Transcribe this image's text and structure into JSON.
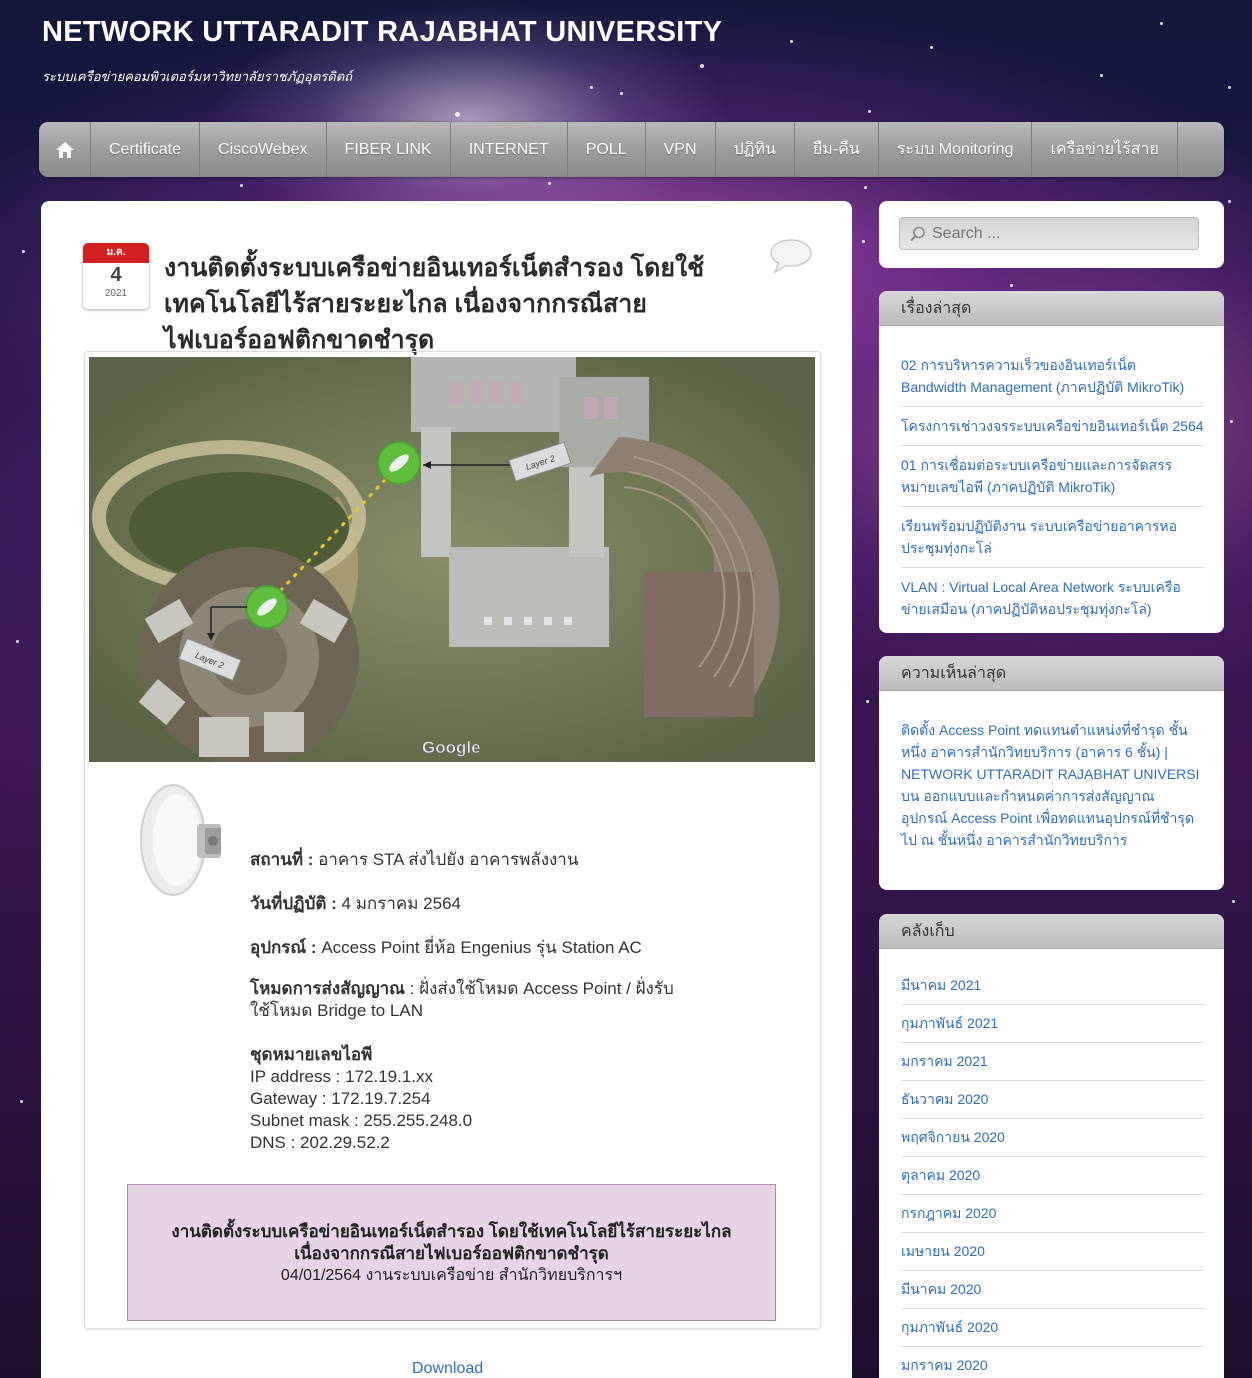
{
  "site": {
    "title": "NETWORK UTTARADIT RAJABHAT UNIVERSITY",
    "subtitle": "ระบบเครือข่ายคอมพิวเตอร์มหาวิทยาลัยราชภัฏอุตรดิตถ์"
  },
  "nav": {
    "items": [
      "Certificate",
      "CiscoWebex",
      "FIBER LINK",
      "INTERNET",
      "POLL",
      "VPN",
      "ปฏิทิน",
      "ยืม-คืน",
      "ระบบ Monitoring",
      "เครือข่ายไร้สาย"
    ]
  },
  "post": {
    "date": {
      "month": "ม.ค.",
      "day": "4",
      "year": "2021"
    },
    "title": "งานติดตั้งระบบเครือข่ายอินเทอร์เน็ตสำรอง โดยใช้เทคโนโลยีไร้สายระยะไกล เนื่องจากกรณีสายไฟเบอร์ออฟติกขาดชำรุด",
    "map_labels": {
      "layer": "Layer 2",
      "google": "Google"
    },
    "location_label": "สถานที่ :",
    "location_value": " อาคาร STA ส่งไปยัง อาคารพลังงาน",
    "date_label": "วันที่ปฏิบัติ :",
    "date_value": " 4 มกราคม 2564",
    "device_label": "อุปกรณ์ :",
    "device_value": " Access Point ยี่ห้อ Engenius รุ่น Station AC",
    "mode_label": "โหมดการส่งสัญญาณ",
    "mode_value": " : ฝั่งส่งใช้โหมด Access Point / ฝั่งรับ",
    "mode_value2": "ใช้โหมด Bridge to LAN",
    "ip_heading": "ชุดหมายเลขไอพี",
    "ip_address": "IP address : 172.19.1.xx",
    "gateway": "Gateway : 172.19.7.254",
    "subnet": "Subnet mask : 255.255.248.0",
    "dns": "DNS : 202.29.52.2",
    "summary_title_1": "งานติดตั้งระบบเครือข่ายอินเทอร์เน็ตสำรอง โดยใช้เทคโนโลยีไร้สายระยะไกล",
    "summary_title_2": "เนื่องจากกรณีสายไฟเบอร์ออฟติกขาดชำรุด",
    "summary_sub": "04/01/2564  งานระบบเครือข่าย สำนักวิทยบริการฯ",
    "download_label": "Download"
  },
  "sidebar": {
    "search_placeholder": "Search ...",
    "recent_posts_title": "เรื่องล่าสุด",
    "recent_posts": [
      "02 การบริหารความเร็วของอินเทอร์เน็ต Bandwidth Management (ภาคปฏิบัติ MikroTik)",
      "โครงการเช่าวงจรระบบเครือข่ายอินเทอร์เน็ต 2564",
      "01 การเชื่อมต่อระบบเครือข่ายและการจัดสรรหมายเลขไอพี (ภาคปฏิบัติ MikroTik)",
      "เรียนพร้อมปฏิบัติงาน ระบบเครือข่ายอาคารหอประชุมทุ่งกะโล่",
      "VLAN : Virtual Local Area Network ระบบเครือข่ายเสมือน (ภาคปฏิบัติหอประชุมทุ่งกะโล่)"
    ],
    "recent_comments_title": "ความเห็นล่าสุด",
    "recent_comment": "ติดตั้ง Access Point ทดแทนตำแหน่งที่ชำรุด ชั้นหนึ่ง อาคารสำนักวิทยบริการ (อาคาร 6 ชั้น) | NETWORK UTTARADIT RAJABHAT UNIVERSI บน ออกแบบและกำหนดค่าการส่งสัญญาณ อุปกรณ์ Access Point เพื่อทดแทนอุปกรณ์ที่ชำรุดไป ณ ชั้นหนึ่ง อาคารสำนักวิทยบริการ",
    "archives_title": "คลังเก็บ",
    "archives": [
      "มีนาคม 2021",
      "กุมภาพันธ์ 2021",
      "มกราคม 2021",
      "ธันวาคม 2020",
      "พฤศจิกายน 2020",
      "ตุลาคม 2020",
      "กรกฎาคม 2020",
      "เมษายน 2020",
      "มีนาคม 2020",
      "กุมภาพันธ์ 2020",
      "มกราคม 2020"
    ]
  },
  "colors": {
    "link": "#2f6fb5",
    "date_badge_red": "#d21f1f",
    "summary_bg": "#e6d3e6"
  }
}
